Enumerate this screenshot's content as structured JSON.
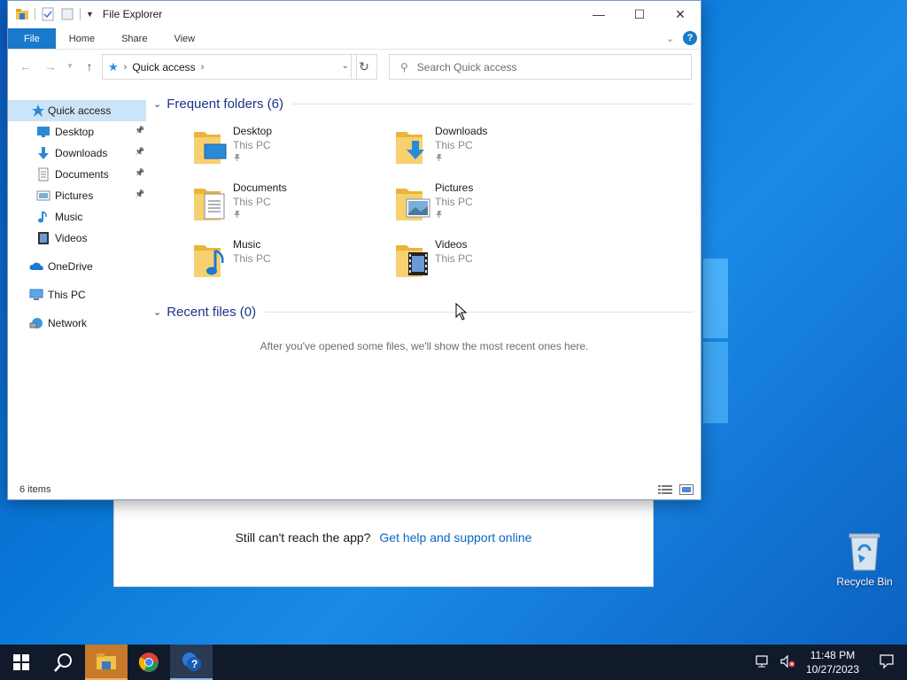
{
  "explorer": {
    "title": "File Explorer",
    "ribbon_tabs": [
      "File",
      "Home",
      "Share",
      "View"
    ],
    "address": {
      "crumb": "Quick access"
    },
    "search": {
      "placeholder": "Search Quick access"
    },
    "nav": [
      {
        "label": "Quick access",
        "icon": "quick-access-star-icon",
        "selected": true,
        "pinned": false
      },
      {
        "label": "Desktop",
        "icon": "desktop-icon",
        "pinned": true
      },
      {
        "label": "Downloads",
        "icon": "downloads-icon",
        "pinned": true
      },
      {
        "label": "Documents",
        "icon": "documents-icon",
        "pinned": true
      },
      {
        "label": "Pictures",
        "icon": "pictures-icon",
        "pinned": true
      },
      {
        "label": "Music",
        "icon": "music-icon",
        "pinned": false
      },
      {
        "label": "Videos",
        "icon": "videos-icon",
        "pinned": false
      },
      {
        "label": "OneDrive",
        "icon": "onedrive-icon",
        "pinned": false
      },
      {
        "label": "This PC",
        "icon": "this-pc-icon",
        "pinned": false
      },
      {
        "label": "Network",
        "icon": "network-icon",
        "pinned": false
      }
    ],
    "frequent_header": "Frequent folders (6)",
    "recent_header": "Recent files (0)",
    "folders": [
      {
        "name": "Desktop",
        "location": "This PC",
        "pinned": true,
        "icon": "desktop-folder-icon"
      },
      {
        "name": "Downloads",
        "location": "This PC",
        "pinned": true,
        "icon": "downloads-folder-icon"
      },
      {
        "name": "Documents",
        "location": "This PC",
        "pinned": true,
        "icon": "documents-folder-icon"
      },
      {
        "name": "Pictures",
        "location": "This PC",
        "pinned": true,
        "icon": "pictures-folder-icon"
      },
      {
        "name": "Music",
        "location": "This PC",
        "pinned": false,
        "icon": "music-folder-icon"
      },
      {
        "name": "Videos",
        "location": "This PC",
        "pinned": false,
        "icon": "videos-folder-icon"
      }
    ],
    "empty_recent_message": "After you've opened some files, we'll show the most recent ones here.",
    "status": {
      "item_count": "6 items"
    }
  },
  "help_window": {
    "question": "Still can't reach the app?",
    "link": "Get help and support online"
  },
  "desktop": {
    "recycle_bin": "Recycle Bin"
  },
  "taskbar": {
    "time": "11:48 PM",
    "date": "10/27/2023"
  },
  "colors": {
    "accent": "#1979ca",
    "selection": "#cce4f7",
    "group_header": "#1e3287",
    "link": "#0a66c2",
    "taskbar": "#101a2a",
    "desktop": "#0a78d8"
  }
}
